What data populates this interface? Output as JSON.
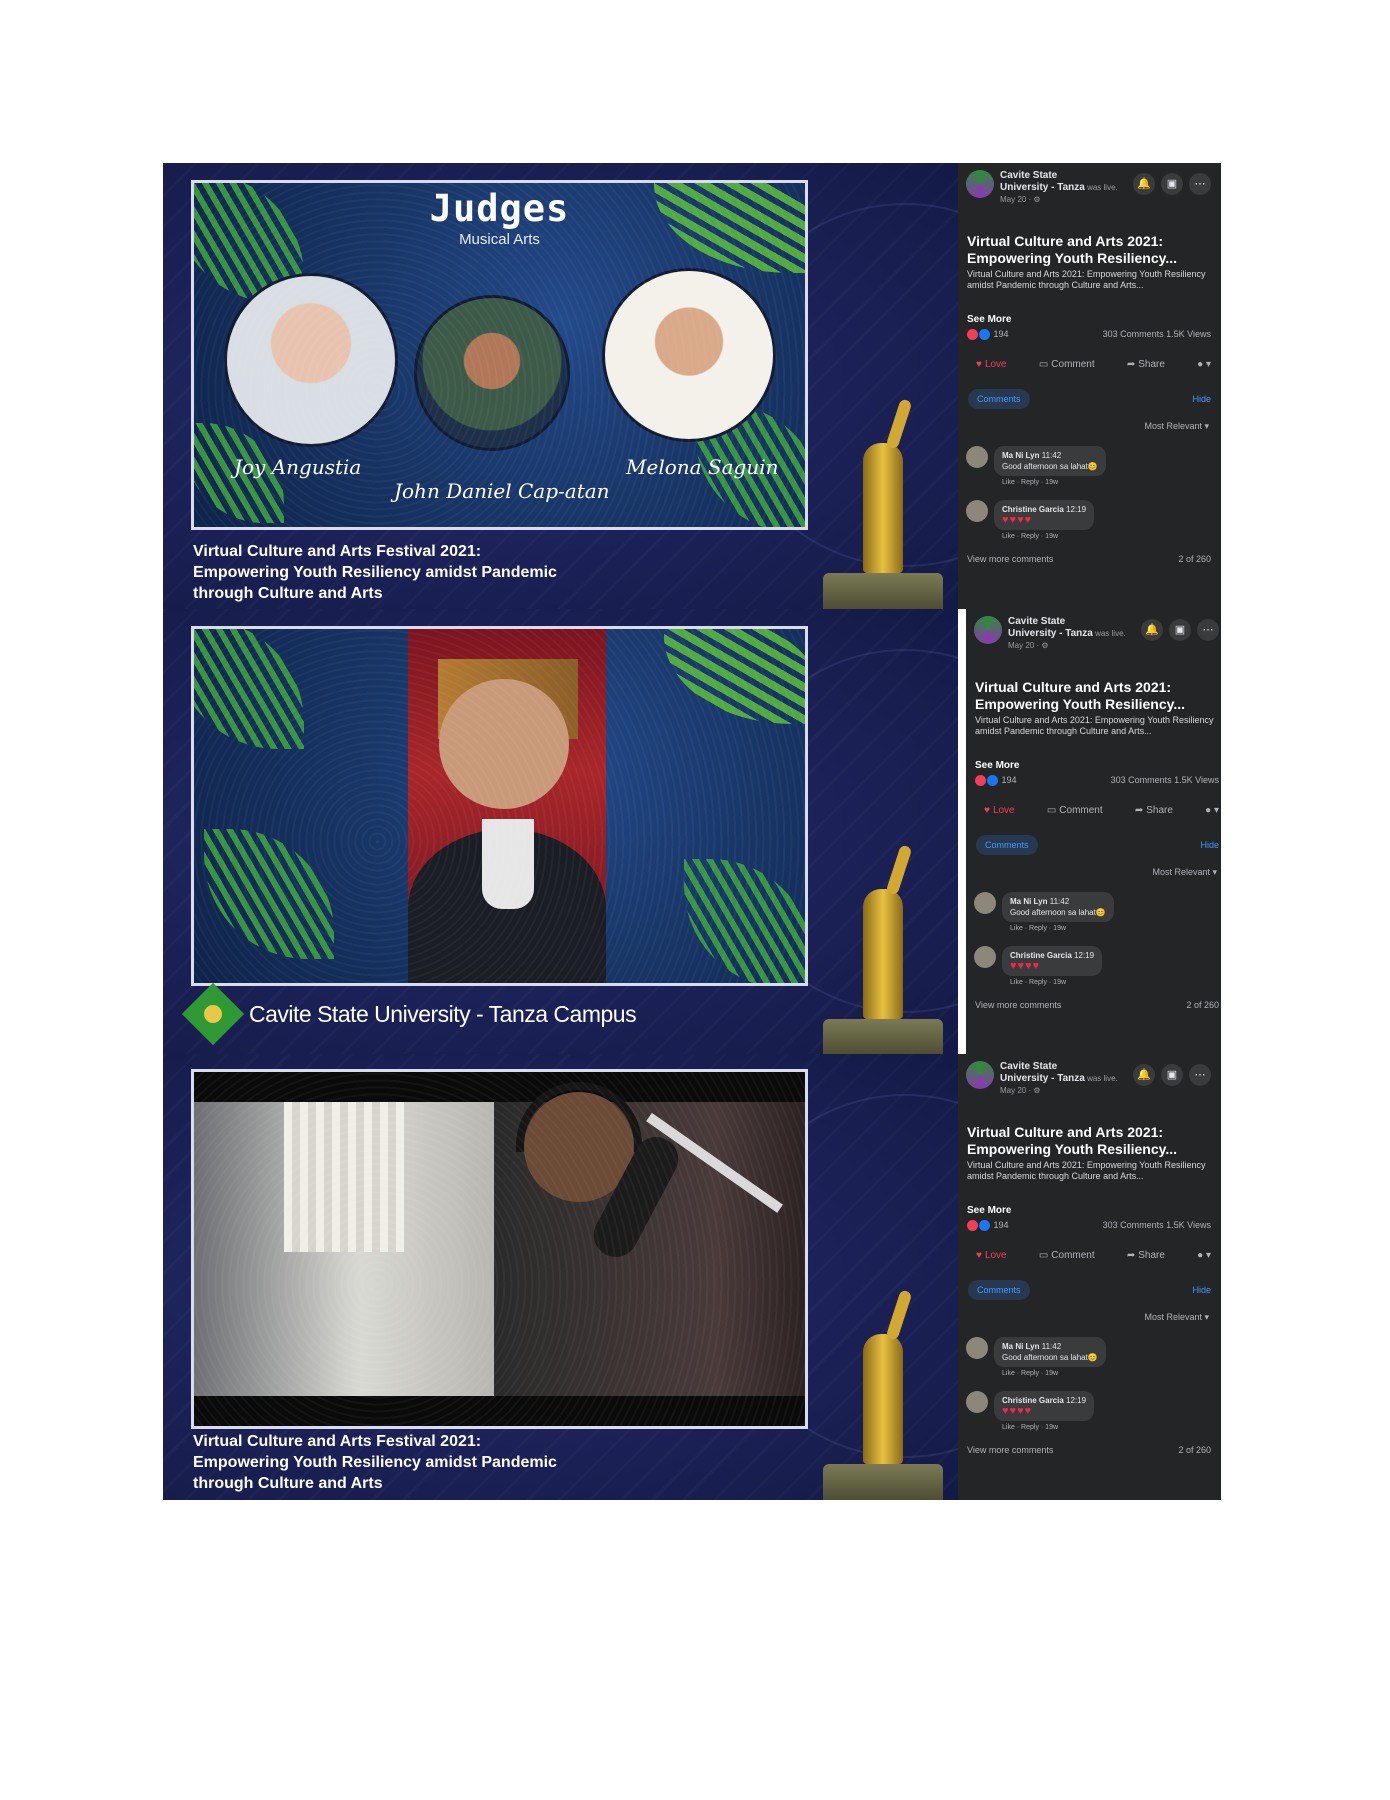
{
  "panel1": {
    "judges_title": "Judges",
    "judges_subtitle": "Musical Arts",
    "judge_names": [
      "Joy Angustia",
      "John Daniel Cap-atan",
      "Melona Saguin"
    ],
    "caption": [
      "Virtual Culture and Arts Festival 2021:",
      "Empowering Youth Resiliency amidst Pandemic",
      "through Culture and Arts"
    ]
  },
  "panel2": {
    "campus_name": "Cavite State University - Tanza Campus"
  },
  "panel3": {
    "caption": [
      "Virtual Culture and Arts Festival 2021:",
      "Empowering Youth Resiliency amidst Pandemic",
      "through Culture and Arts"
    ]
  },
  "facebook": {
    "page_name_line1": "Cavite State",
    "page_name_line2": "University - Tanza",
    "was_live": " was live.",
    "date": "May 20 · ⚙",
    "post_title": "Virtual Culture and Arts 2021: Empowering Youth Resiliency...",
    "post_description": "Virtual Culture and Arts 2021: Empowering Youth Resiliency amidst Pandemic through Culture and Arts...",
    "see_more": "See More",
    "reaction_count": "194",
    "comments_views": "303 Comments  1.5K Views",
    "action_love": "Love",
    "action_comment": "Comment",
    "action_share": "Share",
    "tab_comments": "Comments",
    "hide": "Hide",
    "sort": "Most Relevant ▾",
    "comments": [
      {
        "author": "Ma Ni Lyn",
        "time": "11:42",
        "text": "Good afternoon sa lahat😊",
        "links": "Like · Reply · 19w"
      },
      {
        "author": "Christine Garcia",
        "time": "12:19",
        "text": "♥♥♥♥",
        "links": "Like · Reply · 19w"
      }
    ],
    "view_more": "View more comments",
    "count_of": "2 of 260",
    "icons": [
      "bell-icon",
      "messenger-icon",
      "more-icon"
    ]
  },
  "colors": {
    "stream_bg": "#1b2156",
    "fb_bg": "#242526",
    "fb_blue": "#4599ff",
    "love_red": "#f33e58",
    "campus_green": "#2f9a34"
  }
}
